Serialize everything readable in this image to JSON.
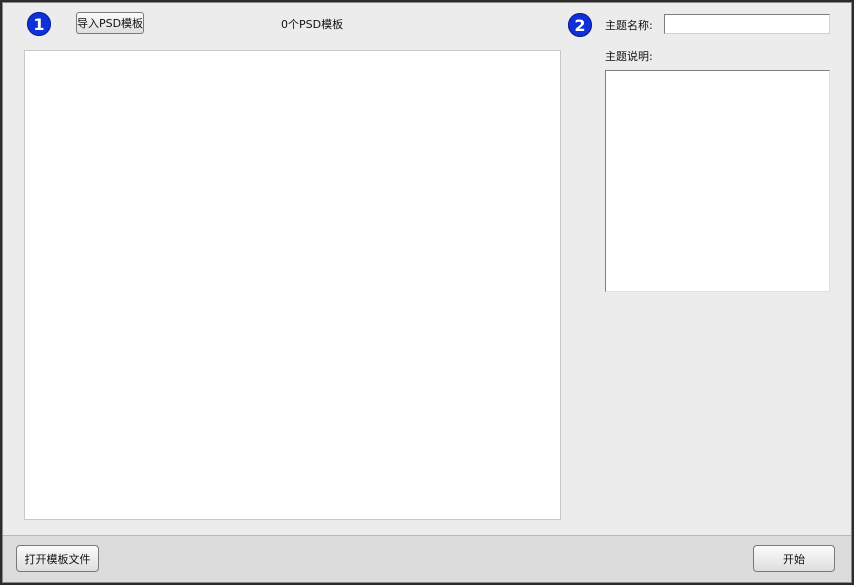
{
  "left": {
    "step_number": "1",
    "import_button_label": "导入PSD模板",
    "template_count_text": "0个PSD模板"
  },
  "right": {
    "step_number": "2",
    "theme_name_label": "主题名称:",
    "theme_name_value": "",
    "theme_desc_label": "主题说明:",
    "theme_desc_value": ""
  },
  "footer": {
    "open_template_button_label": "打开模板文件",
    "start_button_label": "开始"
  }
}
